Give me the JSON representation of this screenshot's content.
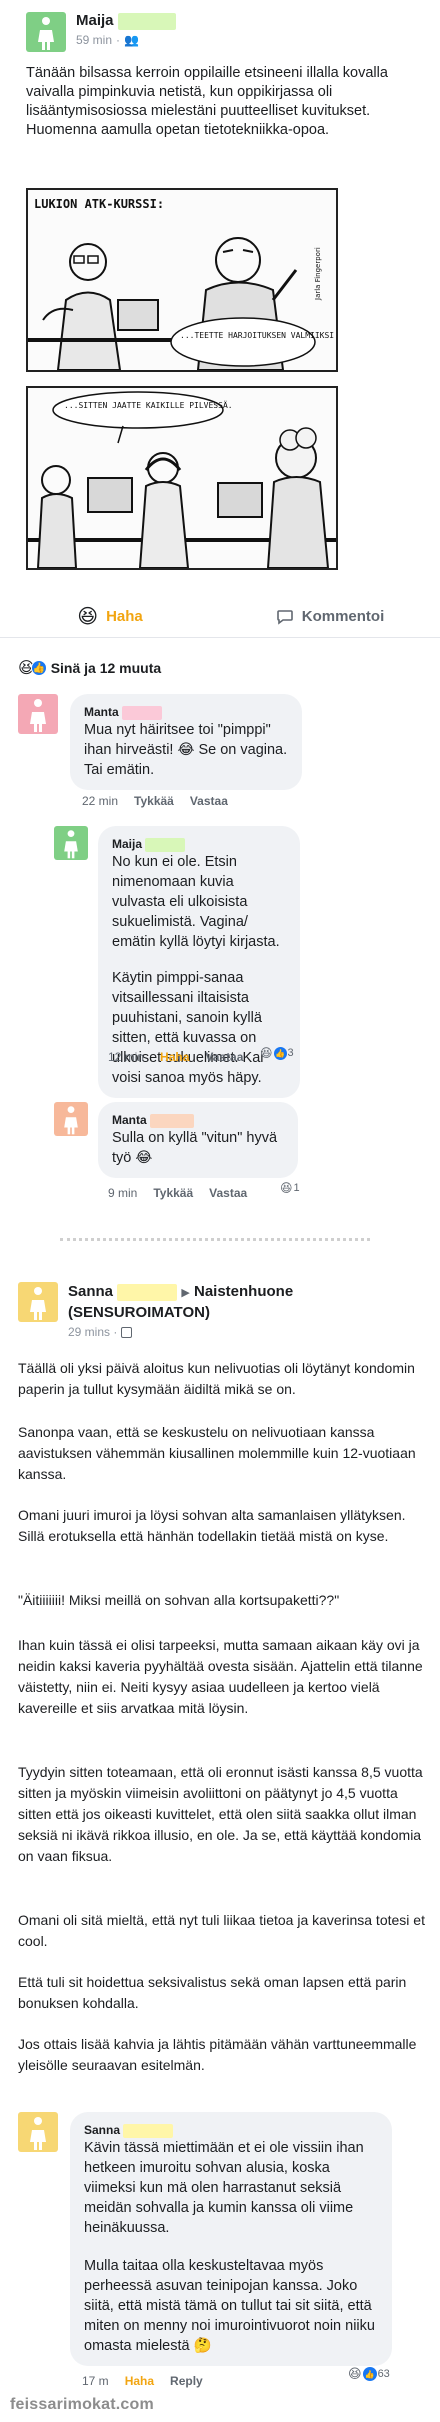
{
  "post1": {
    "author": "Maija",
    "time": "59 min",
    "text": "Tänään bilsassa kerroin oppilaille etsineeni illalla kovalla vaivalla pimpinkuvia netistä, kun oppikirjassa oli lisääntymisosiossa mielestäni puutteelliset kuvitukset. Huomenna aamulla opetan tietotekniikka-opoa.",
    "comic_panel1": {
      "caption": "LUKION ATK-KURSSI:",
      "speech": "...TEETTE HARJOITUKSEN VALMIIKSI VIIKON-LOPUN AIKANA.",
      "signature": "Jarla Fingerpori"
    },
    "comic_panel2": {
      "speech": "...SITTEN JAATTE KAIKILLE PILVESSÄ."
    },
    "actions": {
      "haha": "Haha",
      "comment": "Kommentoi"
    },
    "reactions_summary": "Sinä ja 12 muuta"
  },
  "comments1": [
    {
      "author": "Manta",
      "text": "Mua nyt häiritsee toi \"pimppi\" ihan hirveästi! 😂 Se on vagina. Tai emätin.",
      "time": "22 min",
      "like": "Tykkää",
      "reply": "Vastaa"
    },
    {
      "author": "Maija",
      "text1": "No kun ei ole. Etsin nimenomaan kuvia vulvasta eli ulkoisista sukuelimistä. Vagina/ emätin kyllä löytyi kirjasta.",
      "text2": "Käytin pimppi-sanaa vitsaillessani iltaisista puuhistani, sanoin kyllä sitten, että kuvassa on ulkoiset sukuelimet. Kai voisi sanoa myös häpy.",
      "time": "12 min",
      "like": "Haha",
      "reply": "Vastaa",
      "reaction_count": "3"
    },
    {
      "author": "Manta",
      "text": "Sulla on kyllä \"vitun\" hyvä työ 😂",
      "time": "9 min",
      "like": "Tykkää",
      "reply": "Vastaa",
      "reaction_count": "1"
    }
  ],
  "post2": {
    "author": "Sanna",
    "group_arrow": "▶",
    "group": "Naistenhuone (SENSUROIMATON)",
    "time": "29 mins ·",
    "paragraphs": [
      "Täällä oli yksi päivä aloitus kun nelivuotias oli löytänyt kondomin paperin ja tullut kysymään äidiltä mikä se on.",
      "Sanonpa vaan, että se keskustelu on nelivuotiaan kanssa aavistuksen vähemmän kiusallinen molemmille kuin 12-vuotiaan kanssa.",
      "Omani juuri imuroi ja löysi sohvan alta samanlaisen yllätyksen. Sillä erotuksella että hänhän todellakin tietää mistä on kyse.",
      "\"Äitiiiiiii! Miksi meillä on sohvan alla kortsupaketti??\"",
      "Ihan kuin tässä ei olisi tarpeeksi, mutta samaan aikaan käy ovi ja neidin kaksi kaveria pyyhältää ovesta sisään. Ajattelin että tilanne väistetty, niin ei. Neiti kysyy asiaa uudelleen ja kertoo vielä kavereille et siis arvatkaa mitä löysin.",
      "Tyydyin sitten toteamaan, että oli eronnut isästi kanssa 8,5 vuotta sitten ja myöskin viimeisin avoliittoni on päätynyt jo 4,5 vuotta sitten että jos oikeasti kuvittelet, että olen siitä saakka ollut ilman seksiä ni ikävä rikkoa illusio, en ole. Ja se, että käyttää kondomia on vaan fiksua.",
      "Omani oli sitä mieltä, että nyt tuli liikaa tietoa ja kaverinsa totesi et cool.",
      "Että tuli sit hoidettua seksivalistus sekä oman lapsen että parin bonuksen kohdalla.",
      "Jos ottais lisää kahvia ja lähtis pitämään vähän varttuneemmalle yleisölle seuraavan esitelmän."
    ]
  },
  "comment2": {
    "author": "Sanna",
    "text1": "Kävin tässä miettimään et ei ole vissiin ihan hetkeen imuroitu sohvan alusia, koska viimeksi kun mä olen harrastanut seksiä meidän sohvalla ja kumin kanssa oli viime heinäkuussa.",
    "text2": "Mulla taitaa olla keskusteltavaa myös perheessä asuvan teinipojan kanssa. Joko siitä, että mistä tämä on tullut tai sit siitä, että miten on menny noi imurointivuorot noin niiku omasta mielestä 🤔",
    "time": "17 m",
    "like": "Haha",
    "reply": "Reply",
    "reaction_count": "63"
  },
  "footer": "feissarimokat.com",
  "colors": {
    "avatar_green": "#7fcf85",
    "avatar_pink": "#f4a8b5",
    "avatar_peach": "#f7b89a",
    "avatar_yellow": "#f7d774",
    "haha": "#f2a511",
    "bubble": "#f0f2f5"
  }
}
